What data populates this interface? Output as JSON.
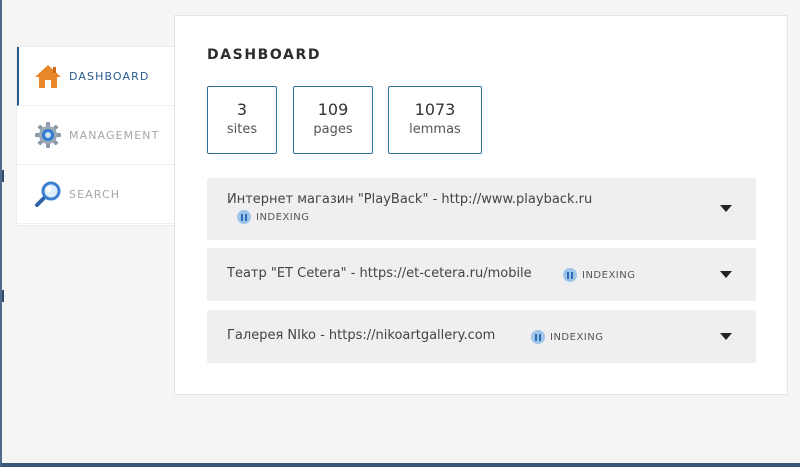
{
  "sidebar": {
    "items": [
      {
        "label": "DASHBOARD",
        "icon": "home-icon",
        "active": true
      },
      {
        "label": "MANAGEMENT",
        "icon": "gear-icon",
        "active": false
      },
      {
        "label": "SEARCH",
        "icon": "magnifier-icon",
        "active": false
      }
    ]
  },
  "dashboard": {
    "title": "DASHBOARD",
    "stats": [
      {
        "value": "3",
        "label": "sites"
      },
      {
        "value": "109",
        "label": "pages"
      },
      {
        "value": "1073",
        "label": "lemmas"
      }
    ],
    "sites": [
      {
        "name": "Интернет магазин \"PlayBack\" - http://www.playback.ru",
        "status": "INDEXING"
      },
      {
        "name": "Театр \"ET Cetera\" - https://et-cetera.ru/mobile",
        "status": "INDEXING"
      },
      {
        "name": "Галерея NIko - https://nikoartgallery.com",
        "status": "INDEXING"
      }
    ]
  },
  "colors": {
    "accent": "#2a6fa0",
    "status_dot": "#9fc4ea",
    "home_icon": "#e8862a"
  }
}
